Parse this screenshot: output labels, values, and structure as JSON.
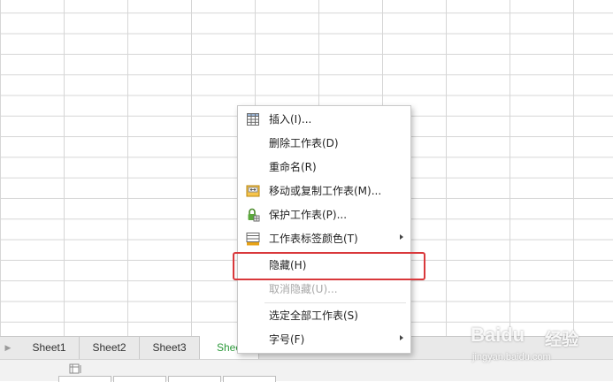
{
  "context_menu": {
    "items": [
      {
        "label": "插入(I)...",
        "icon": "table-insert-icon"
      },
      {
        "label": "删除工作表(D)"
      },
      {
        "label": "重命名(R)"
      },
      {
        "label": "移动或复制工作表(M)...",
        "icon": "move-copy-icon"
      },
      {
        "label": "保护工作表(P)...",
        "icon": "lock-sheet-icon"
      },
      {
        "label": "工作表标签颜色(T)",
        "icon": "tab-color-icon",
        "submenu": true
      },
      {
        "label": "隐藏(H)",
        "highlighted": true
      },
      {
        "label": "取消隐藏(U)...",
        "disabled": true
      },
      {
        "label": "选定全部工作表(S)"
      },
      {
        "label": "字号(F)",
        "submenu": true
      }
    ]
  },
  "sheet_tabs": {
    "tabs": [
      "Sheet1",
      "Sheet2",
      "Sheet3",
      "Shee"
    ],
    "active_index": 3
  },
  "watermark": {
    "brand": "Baidu",
    "suffix": "经验",
    "url": "jingyan.baidu.com"
  },
  "colors": {
    "accent": "#2e9a3c",
    "highlight_border": "#d9383b",
    "grid_line": "#d6d6d6"
  }
}
